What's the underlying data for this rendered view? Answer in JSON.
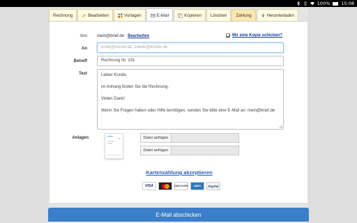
{
  "statusbar": {
    "battery": "100%",
    "time": "15:08"
  },
  "tabs": [
    {
      "label": "Rechnung",
      "icon": "",
      "active": false
    },
    {
      "label": "Bearbeiten",
      "icon": "pencil-icon",
      "active": false
    },
    {
      "label": "Vorlagen",
      "icon": "templates-icon",
      "active": false
    },
    {
      "label": "E-Mail",
      "icon": "mail-icon",
      "active": true
    },
    {
      "label": "Kopieren",
      "icon": "copy-icon",
      "active": false
    },
    {
      "label": "Löschen",
      "icon": "",
      "active": false
    },
    {
      "label": "Zahlung",
      "icon": "",
      "active": false
    },
    {
      "label": "Herunterladen",
      "icon": "download-icon",
      "active": false
    }
  ],
  "form": {
    "von_label": "Von",
    "von_value": "mein@brief.de",
    "edit_link": "Bearbeiten",
    "copy_label": "Mir eine Kopie schicken?",
    "an_label": "An",
    "an_placeholder": "erste@kunde.de, zweite@kunde.de",
    "betreff_label": "Betreff",
    "betreff_value": "Rechnung Nr. 101",
    "text_label": "Text",
    "text_lines": [
      "Lieber Kunde,",
      "im Anhang finden Sie die Rechnung.",
      "Vielen Dank!",
      "Wenn Sie Fragen haben oder Hilfe benötigen, senden Sie bitte eine E-Mail an: mein@brief.de"
    ],
    "anlagen_label": "Anlagen",
    "attach_button_1": "Datei anfügen",
    "attach_button_2": "Datei anfügen"
  },
  "payment": {
    "link": "Kartenzahlung akzeptieren",
    "cards": [
      "VISA",
      "MasterCard",
      "DISCOVER",
      "AMERICAN EXPRESS",
      "PayPal"
    ]
  },
  "send_button": "E-Mail abschicken",
  "colors": {
    "accent": "#3b7ec9",
    "link": "#2a60b8",
    "tab_bg": "#fffbe0"
  }
}
